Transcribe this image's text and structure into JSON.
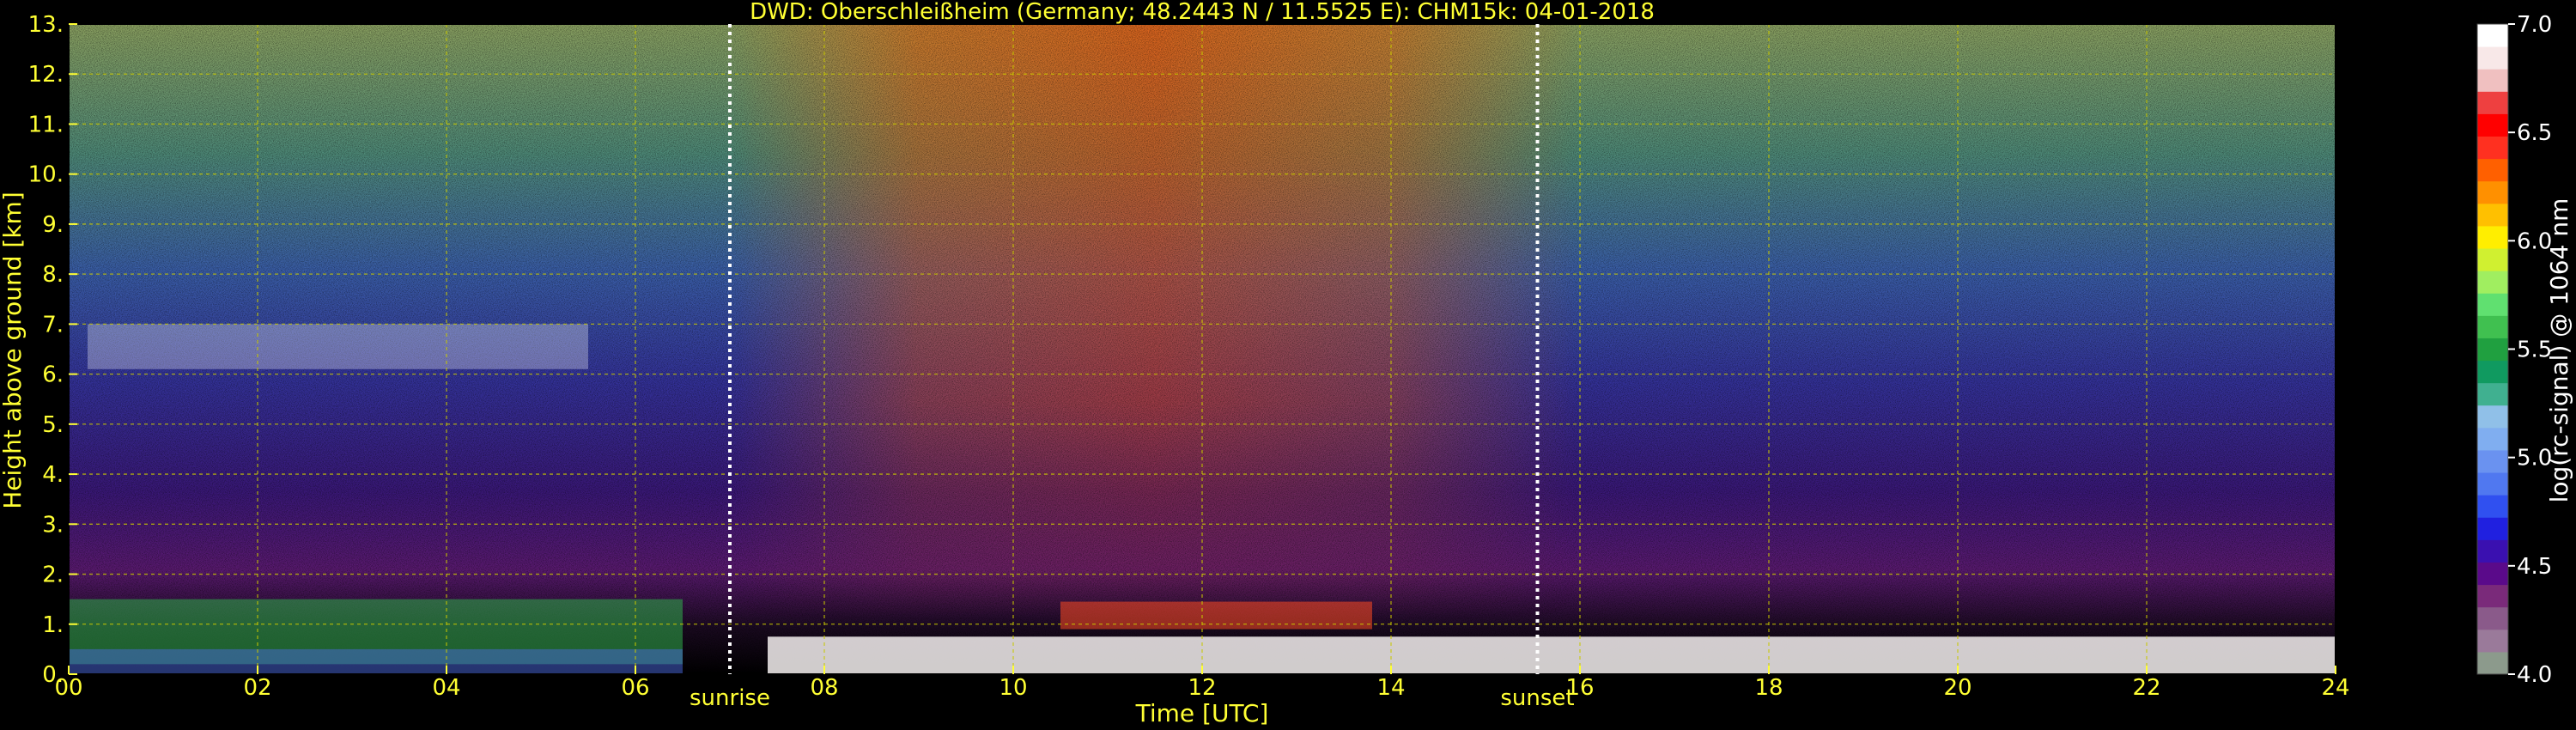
{
  "chart_data": {
    "type": "heatmap",
    "title": "DWD: Oberschleißheim (Germany; 48.2443 N / 11.5525 E):    CHM15k: 04-01-2018",
    "xlabel": "Time [UTC]",
    "ylabel": "Height above ground [km]",
    "xlim": [
      0,
      24
    ],
    "ylim": [
      0,
      13
    ],
    "x_ticks": [
      "00",
      "02",
      "04",
      "06",
      "08",
      "10",
      "12",
      "14",
      "16",
      "18",
      "20",
      "22",
      "24"
    ],
    "x_tick_values": [
      0,
      2,
      4,
      6,
      8,
      10,
      12,
      14,
      16,
      18,
      20,
      22,
      24
    ],
    "y_ticks": [
      "0.",
      "1.",
      "2.",
      "3.",
      "4.",
      "5.",
      "6.",
      "7.",
      "8.",
      "9.",
      "10.",
      "11.",
      "12.",
      "13."
    ],
    "y_tick_values": [
      0,
      1,
      2,
      3,
      4,
      5,
      6,
      7,
      8,
      9,
      10,
      11,
      12,
      13
    ],
    "grid": true,
    "markers": [
      {
        "label": "sunrise",
        "x": 7.0
      },
      {
        "label": "sunset",
        "x": 15.55
      }
    ],
    "colorbar": {
      "label": "log(rc-signal) @ 1064 nm",
      "range": [
        4.0,
        7.0
      ],
      "ticks": [
        "4.0",
        "4.5",
        "5.0",
        "5.5",
        "6.0",
        "6.5",
        "7.0"
      ],
      "tick_values": [
        4.0,
        4.5,
        5.0,
        5.5,
        6.0,
        6.5,
        7.0
      ],
      "colors": [
        "#8c9a8c",
        "#9a7a9a",
        "#8a5a8a",
        "#7a2a7a",
        "#5a0a8a",
        "#3a10b0",
        "#2020e0",
        "#3050f0",
        "#5078f0",
        "#6a92f0",
        "#80aef0",
        "#90c0e8",
        "#40b090",
        "#109a60",
        "#20a040",
        "#40c050",
        "#60e070",
        "#a0ee60",
        "#d0f030",
        "#ffee00",
        "#ffc000",
        "#ff9000",
        "#ff6000",
        "#ff3020",
        "#ff0000",
        "#ee4040",
        "#f0c0c0",
        "#f8e8e8",
        "#ffffff"
      ]
    },
    "colors": {
      "text": "#ffff33",
      "grid": "#c8c800",
      "background": "#000000",
      "marker": "#ffffff"
    }
  }
}
